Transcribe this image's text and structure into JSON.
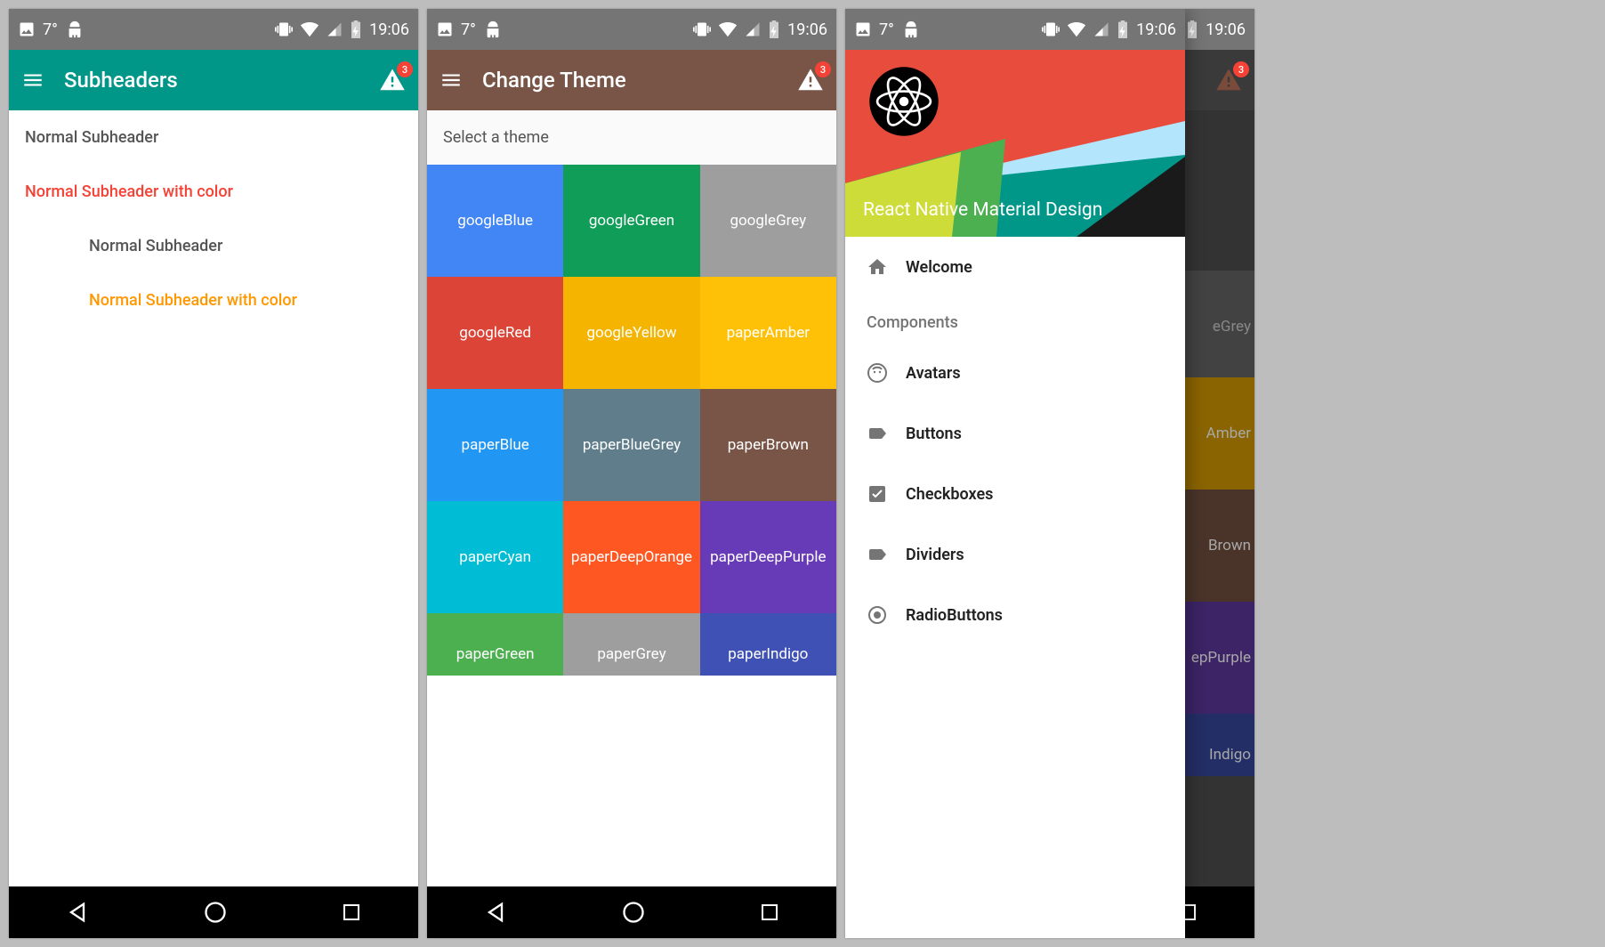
{
  "status": {
    "temp": "7°",
    "time": "19:06"
  },
  "badge_count": "3",
  "screen1": {
    "appbar_title": "Subheaders",
    "subheaders": {
      "a": "Normal Subheader",
      "b": "Normal Subheader with color",
      "c": "Normal Subheader",
      "d": "Normal Subheader with color"
    }
  },
  "screen2": {
    "appbar_title": "Change Theme",
    "section": "Select a theme",
    "tiles": [
      {
        "label": "googleBlue",
        "bg": "#4285f4"
      },
      {
        "label": "googleGreen",
        "bg": "#0f9d58"
      },
      {
        "label": "googleGrey",
        "bg": "#9e9e9e"
      },
      {
        "label": "googleRed",
        "bg": "#db4437"
      },
      {
        "label": "googleYellow",
        "bg": "#f4b400"
      },
      {
        "label": "paperAmber",
        "bg": "#ffc107"
      },
      {
        "label": "paperBlue",
        "bg": "#2196f3"
      },
      {
        "label": "paperBlueGrey",
        "bg": "#607d8b"
      },
      {
        "label": "paperBrown",
        "bg": "#795548"
      },
      {
        "label": "paperCyan",
        "bg": "#00bcd4"
      },
      {
        "label": "paperDeepOrange",
        "bg": "#ff5722"
      },
      {
        "label": "paperDeepPurple",
        "bg": "#673ab7"
      },
      {
        "label": "paperGreen",
        "bg": "#4caf50"
      },
      {
        "label": "paperGrey",
        "bg": "#9e9e9e"
      },
      {
        "label": "paperIndigo",
        "bg": "#3f51b5"
      }
    ]
  },
  "screen3": {
    "drawer_title": "React Native Material Design",
    "welcome": "Welcome",
    "components_header": "Components",
    "items": {
      "avatars": "Avatars",
      "buttons": "Buttons",
      "checkboxes": "Checkboxes",
      "dividers": "Dividers",
      "radiobuttons": "RadioButtons"
    },
    "peek": {
      "grey": "eGrey",
      "amber": "Amber",
      "brown": "Brown",
      "purple": "epPurple",
      "indigo": "Indigo"
    }
  }
}
